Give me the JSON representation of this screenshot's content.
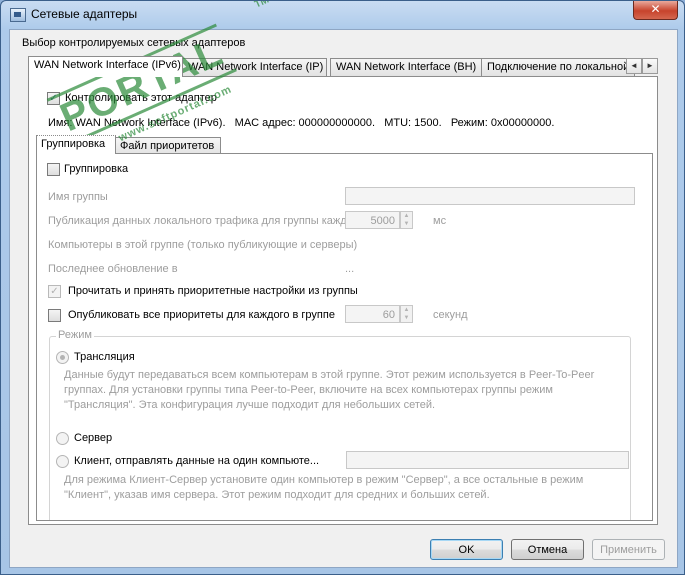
{
  "window": {
    "title": "Сетевые адаптеры",
    "close_glyph": "✕"
  },
  "section_label": "Выбор контролируемых сетевых адаптеров",
  "adapter_tabs": [
    {
      "label": "WAN Network Interface (IPv6)",
      "active": true
    },
    {
      "label": "WAN Network Interface (IP)",
      "active": false
    },
    {
      "label": "WAN Network Interface (BH)",
      "active": false
    },
    {
      "label": "Подключение по локальной",
      "active": false
    }
  ],
  "tab_scroll": {
    "left": "◄",
    "right": "►"
  },
  "adapter": {
    "monitor_label": "Контролировать этот адаптер",
    "monitor_checked": true,
    "info": "Имя: WAN Network Interface (IPv6).   MAC адрес: 000000000000.   MTU: 1500.   Режим: 0x00000000."
  },
  "inner_tabs": [
    {
      "label": "Группировка",
      "active": true
    },
    {
      "label": "Файл приоритетов",
      "active": false
    }
  ],
  "grouping": {
    "enable_label": "Группировка",
    "enable_checked": false,
    "group_name_label": "Имя группы",
    "group_name_value": "",
    "publish_label": "Публикация данных локального трафика для группы каждые",
    "publish_value": "5000",
    "publish_unit": "мс",
    "computers_label": "Компьютеры в этой группе (только публикующие и серверы)",
    "last_update_label": "Последнее обновление в",
    "last_update_value": "...",
    "read_priorities_label": "Прочитать и принять приоритетные настройки из группы",
    "read_priorities_checked": true,
    "publish_priorities_label": "Опубликовать все приоритеты для каждого в группе",
    "publish_priorities_checked": false,
    "publish_priorities_value": "60",
    "publish_priorities_unit": "секунд"
  },
  "mode": {
    "title": "Режим",
    "broadcast_label": "Трансляция",
    "broadcast_selected": true,
    "broadcast_desc": [
      "Данные будут передаваться всем компьютерам в этой группе. Этот режим используется в Peer-To-Peer",
      "группах. Для установки группы типа Peer-to-Peer, включите на всех компьютерах группы режим",
      "\"Трансляция\". Эта конфигурация лучше подходит для небольших сетей."
    ],
    "server_label": "Сервер",
    "client_label": "Клиент, отправлять данные на один компьюте...",
    "client_value": "",
    "client_desc": [
      "Для режима Клиент-Сервер установите один компьютер в режим \"Сервер\", а все остальные в режим",
      "\"Клиент\", указав имя сервера. Этот режим подходит для средних и больших сетей."
    ]
  },
  "buttons": {
    "ok": "OK",
    "cancel": "Отмена",
    "apply": "Применить"
  },
  "watermark": {
    "text": "PORTAL",
    "tm": "TM",
    "site": "www.softportal.com"
  },
  "colors": {
    "title_bar": "#aecbeb",
    "close_button": "#c7432c",
    "watermark": "#2b8a3a",
    "disabled_text": "#9d9d9d"
  }
}
